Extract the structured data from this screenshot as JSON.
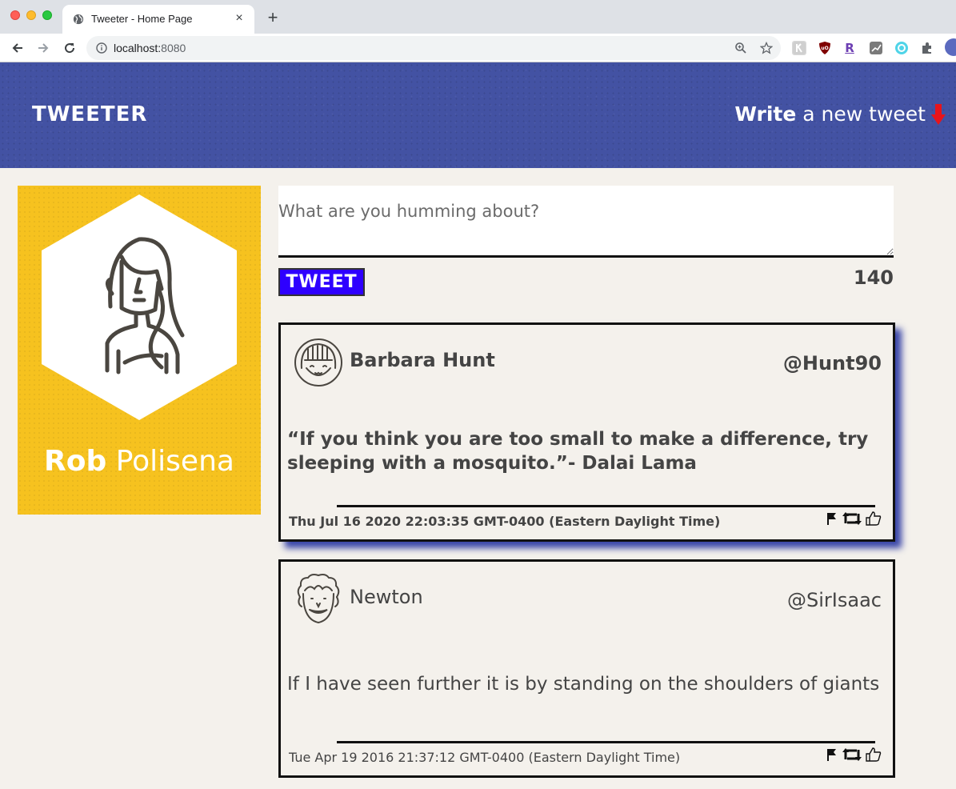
{
  "browser": {
    "tab_title": "Tweeter - Home Page",
    "new_tab": "+",
    "tab_close": "×",
    "url_host": "localhost:",
    "url_port": "8080",
    "extensions": [
      {
        "icon": "r-extension-icon",
        "label": "R",
        "color": "#6d3fb3"
      }
    ]
  },
  "header": {
    "logo": "TWEETER",
    "compose_bold": "Write",
    "compose_rest": " a new tweet"
  },
  "profile": {
    "first_name": "Rob",
    "last_name": " Polisena",
    "background": "#f6c21f"
  },
  "composer": {
    "placeholder": "What are you humming about?",
    "button_label": "TWEET",
    "counter": "140",
    "button_color": "#2e00ff"
  },
  "tweets": [
    {
      "name": "Barbara Hunt",
      "handle": "@Hunt90",
      "body": "“If you think you are too small to make a difference, try sleeping with a mosquito.”- Dalai Lama",
      "date": "Thu Jul 16 2020 22:03:35 GMT-0400 (Eastern Daylight Time)",
      "bold": true
    },
    {
      "name": "Newton",
      "handle": "@SirIsaac",
      "body": "If I have seen further it is by standing on the shoulders of giants",
      "date": "Tue Apr 19 2016 21:37:12 GMT-0400 (Eastern Daylight Time)",
      "bold": false
    }
  ],
  "colors": {
    "header_bg": "#4352a3",
    "page_bg": "#f4f1ec",
    "tweet_shadow": "#3a46a8",
    "arrow": "#e8141b"
  }
}
